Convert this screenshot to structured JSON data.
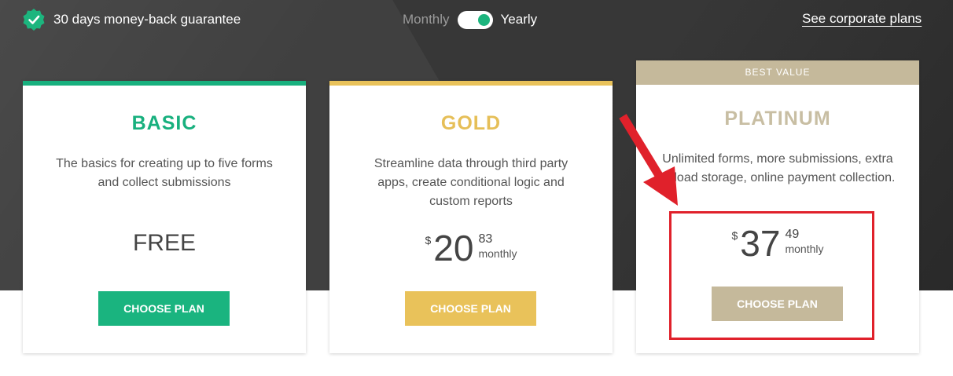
{
  "header": {
    "guarantee_text": "30 days money-back guarantee",
    "billing_toggle": {
      "off_label": "Monthly",
      "on_label": "Yearly",
      "selected": "Yearly"
    },
    "corporate_link": "See corporate plans"
  },
  "plans": [
    {
      "name": "BASIC",
      "description": "The basics for creating up to five forms and collect submissions",
      "price_text": "FREE",
      "button_label": "CHOOSE PLAN",
      "color": "#18b07e"
    },
    {
      "name": "GOLD",
      "description": "Streamline data through third party apps, create conditional logic and custom reports",
      "currency": "$",
      "price_whole": "20",
      "price_cents": "83",
      "period": "monthly",
      "button_label": "CHOOSE PLAN",
      "color": "#e9c25a"
    },
    {
      "ribbon": "BEST VALUE",
      "name": "PLATINUM",
      "description": "Unlimited forms, more submissions, extra upload storage, online payment collection.",
      "currency": "$",
      "price_whole": "37",
      "price_cents": "49",
      "period": "monthly",
      "button_label": "CHOOSE PLAN",
      "color": "#c5b99b"
    }
  ],
  "annotation": {
    "highlight_color": "#e0212b"
  }
}
